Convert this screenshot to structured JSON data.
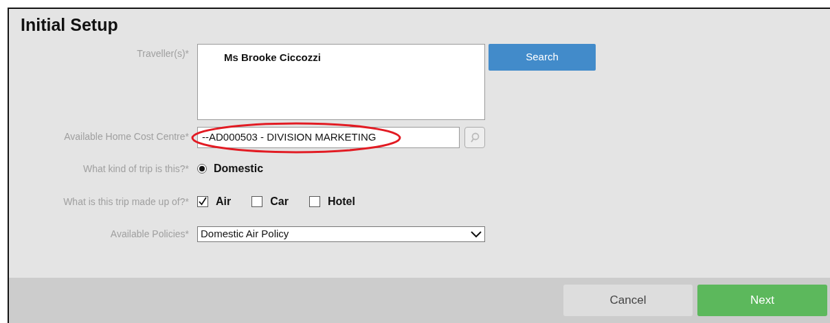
{
  "title": "Initial Setup",
  "fields": [
    {
      "kind": "list",
      "label": "Traveller(s)*",
      "value": "Ms Brooke Ciccozzi",
      "button": "Search"
    },
    {
      "kind": "lookup",
      "label": "Available Home Cost Centre*",
      "value": "--AD000503 - DIVISION MARKETING",
      "highlighted": true
    },
    {
      "kind": "radio",
      "label": "What kind of trip is this?*",
      "options": [
        {
          "label": "Domestic",
          "selected": true
        }
      ]
    },
    {
      "kind": "checkbox",
      "label": "What is this trip made up of?*",
      "options": [
        {
          "label": "Air",
          "checked": true
        },
        {
          "label": "Car",
          "checked": false
        },
        {
          "label": "Hotel",
          "checked": false
        }
      ]
    },
    {
      "kind": "select",
      "label": "Available Policies*",
      "value": "Domestic Air Policy"
    }
  ],
  "buttons": [
    {
      "label": "Cancel",
      "kind": "secondary"
    },
    {
      "label": "Next",
      "kind": "primary"
    }
  ]
}
